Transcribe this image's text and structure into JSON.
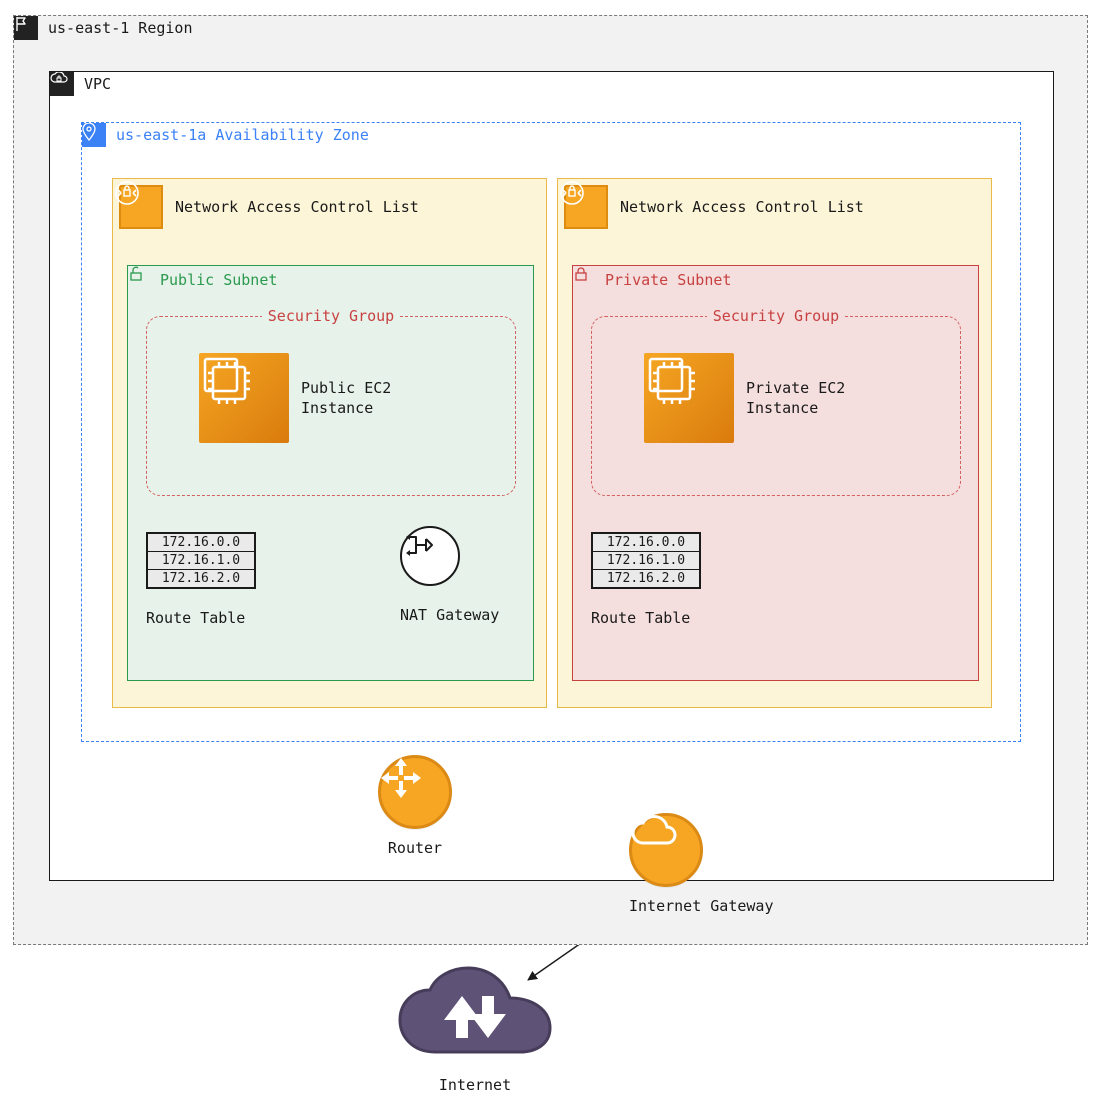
{
  "region": {
    "label": "us-east-1 Region"
  },
  "vpc": {
    "label": "VPC"
  },
  "az": {
    "label": "us-east-1a Availability Zone"
  },
  "nacl": {
    "label": "Network Access Control List"
  },
  "public_subnet": {
    "label": "Public Subnet",
    "security_group": "Security Group",
    "ec2": "Public EC2\nInstance",
    "route_table_caption": "Route Table",
    "routes": [
      "172.16.0.0",
      "172.16.1.0",
      "172.16.2.0"
    ],
    "nat_label": "NAT Gateway"
  },
  "private_subnet": {
    "label": "Private Subnet",
    "security_group": "Security Group",
    "ec2": "Private EC2\nInstance",
    "route_table_caption": "Route Table",
    "routes": [
      "172.16.0.0",
      "172.16.1.0",
      "172.16.2.0"
    ]
  },
  "router": {
    "label": "Router"
  },
  "igw": {
    "label": "Internet Gateway"
  },
  "internet": {
    "label": "Internet"
  },
  "colors": {
    "orange": "#f6a623",
    "orange_dark": "#d97b0d",
    "blue": "#3b82f6",
    "green": "#2b9a4e",
    "red": "#c84141",
    "purple": "#5e5277"
  }
}
